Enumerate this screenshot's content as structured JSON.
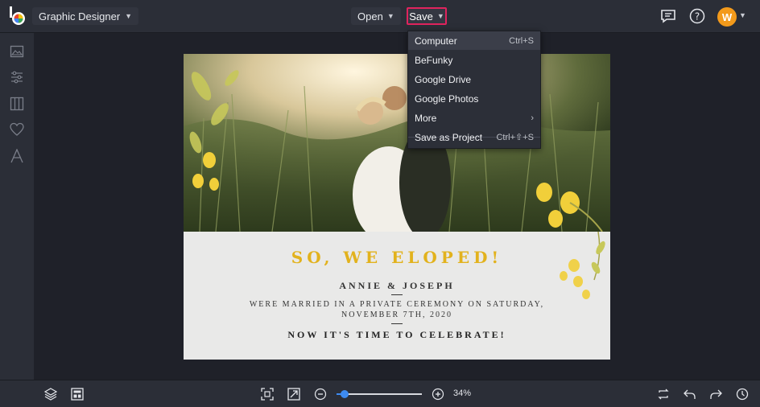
{
  "header": {
    "workspace_label": "Graphic Designer",
    "open_label": "Open",
    "save_label": "Save",
    "avatar_initial": "W"
  },
  "save_menu": {
    "items": [
      {
        "label": "Computer",
        "shortcut": "Ctrl+S",
        "active": true
      },
      {
        "label": "BeFunky",
        "shortcut": ""
      },
      {
        "label": "Google Drive",
        "shortcut": ""
      },
      {
        "label": "Google Photos",
        "shortcut": ""
      },
      {
        "label": "More",
        "shortcut": "›"
      },
      {
        "label": "Save as Project",
        "shortcut": "Ctrl+⇧+S"
      }
    ]
  },
  "card": {
    "headline": "SO, WE ELOPED!",
    "names": "ANNIE & JOSEPH",
    "married_line1": "WERE MARRIED IN A PRIVATE CEREMONY ON SATURDAY,",
    "married_line2": "NOVEMBER 7TH, 2020",
    "celebrate": "NOW IT'S TIME TO CELEBRATE!"
  },
  "zoom": {
    "label": "34%",
    "level": 0.09
  },
  "colors": {
    "accent_save_border": "#e0245e",
    "avatar_bg": "#f39a1b",
    "headline_gold": "#e2b21d",
    "slider_blue": "#3d8bf2"
  },
  "icons": {
    "left_toolbar": [
      "image-icon",
      "sliders-icon",
      "columns-icon",
      "heart-icon",
      "text-icon"
    ],
    "top_right": [
      "chat-icon",
      "help-icon"
    ],
    "bottom_left": [
      "layers-icon",
      "layout-icon"
    ],
    "bottom_right": [
      "swap-icon",
      "undo-icon",
      "redo-icon",
      "history-icon"
    ]
  }
}
